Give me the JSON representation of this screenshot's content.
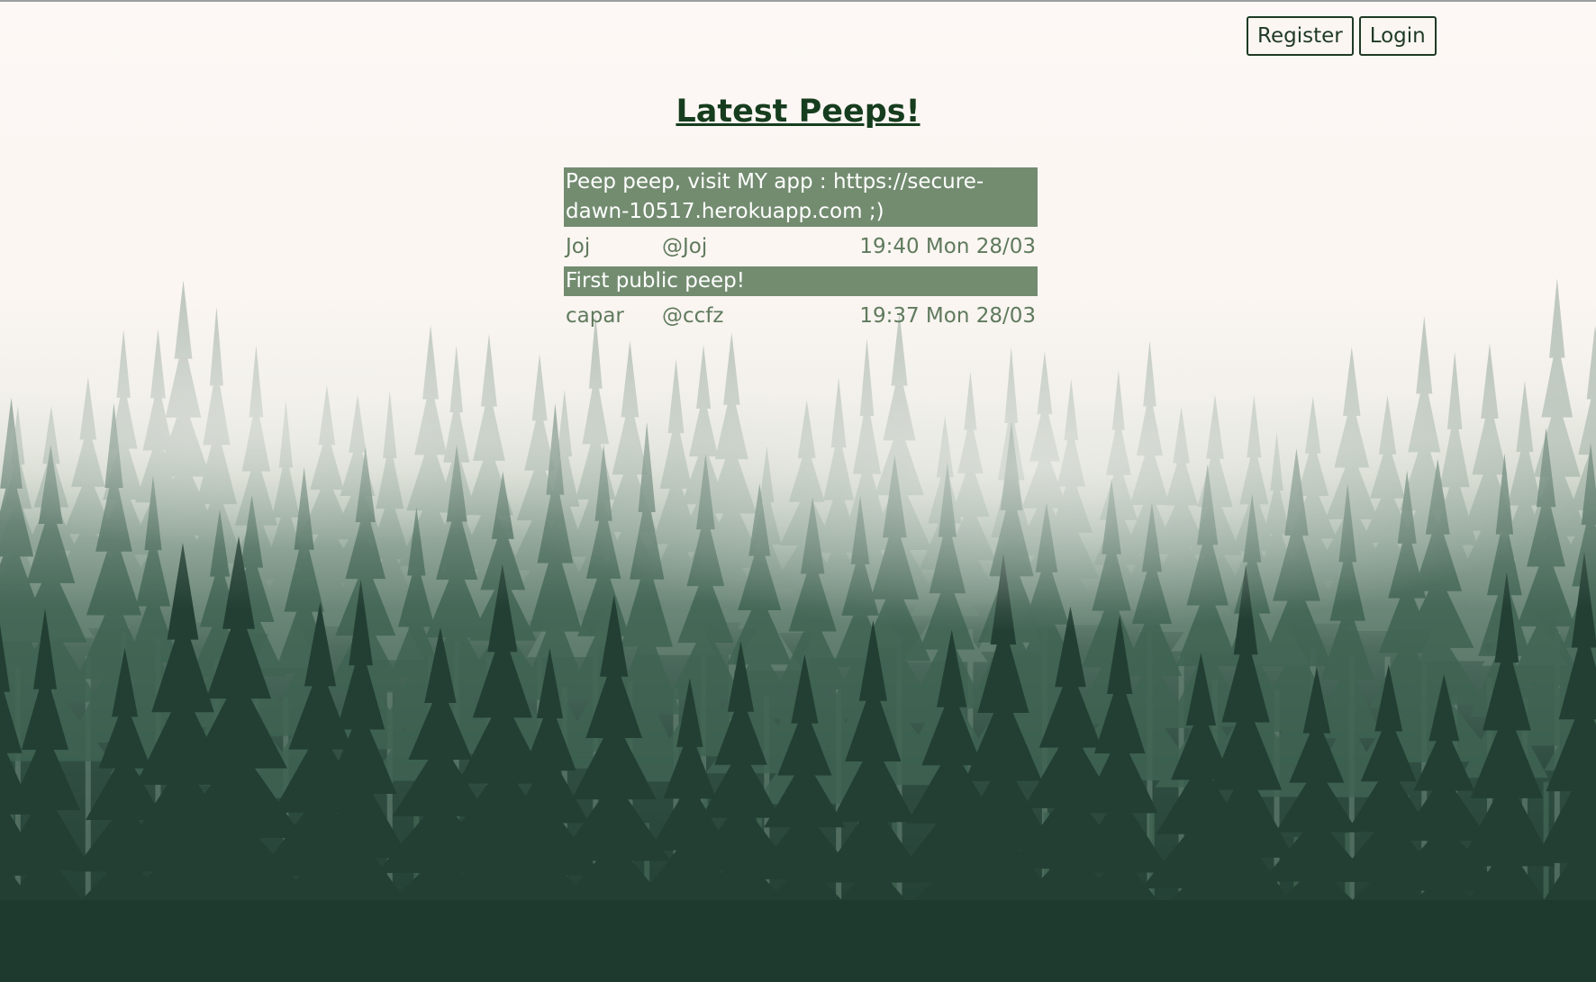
{
  "header": {
    "register_label": "Register",
    "login_label": "Login"
  },
  "main": {
    "title": "Latest Peeps!",
    "peeps": [
      {
        "text": "Peep peep, visit MY app : https://secure-dawn-10517.herokuapp.com ;)",
        "name": "Joj",
        "handle": "@Joj",
        "time": "19:40 Mon 28/03"
      },
      {
        "text": "First public peep!",
        "name": "capar",
        "handle": "@ccfz",
        "time": "19:37 Mon 28/03"
      }
    ]
  },
  "colors": {
    "accent": "#163d1e",
    "peep_bg": "#738c70",
    "meta_text": "#5f7a5d"
  }
}
